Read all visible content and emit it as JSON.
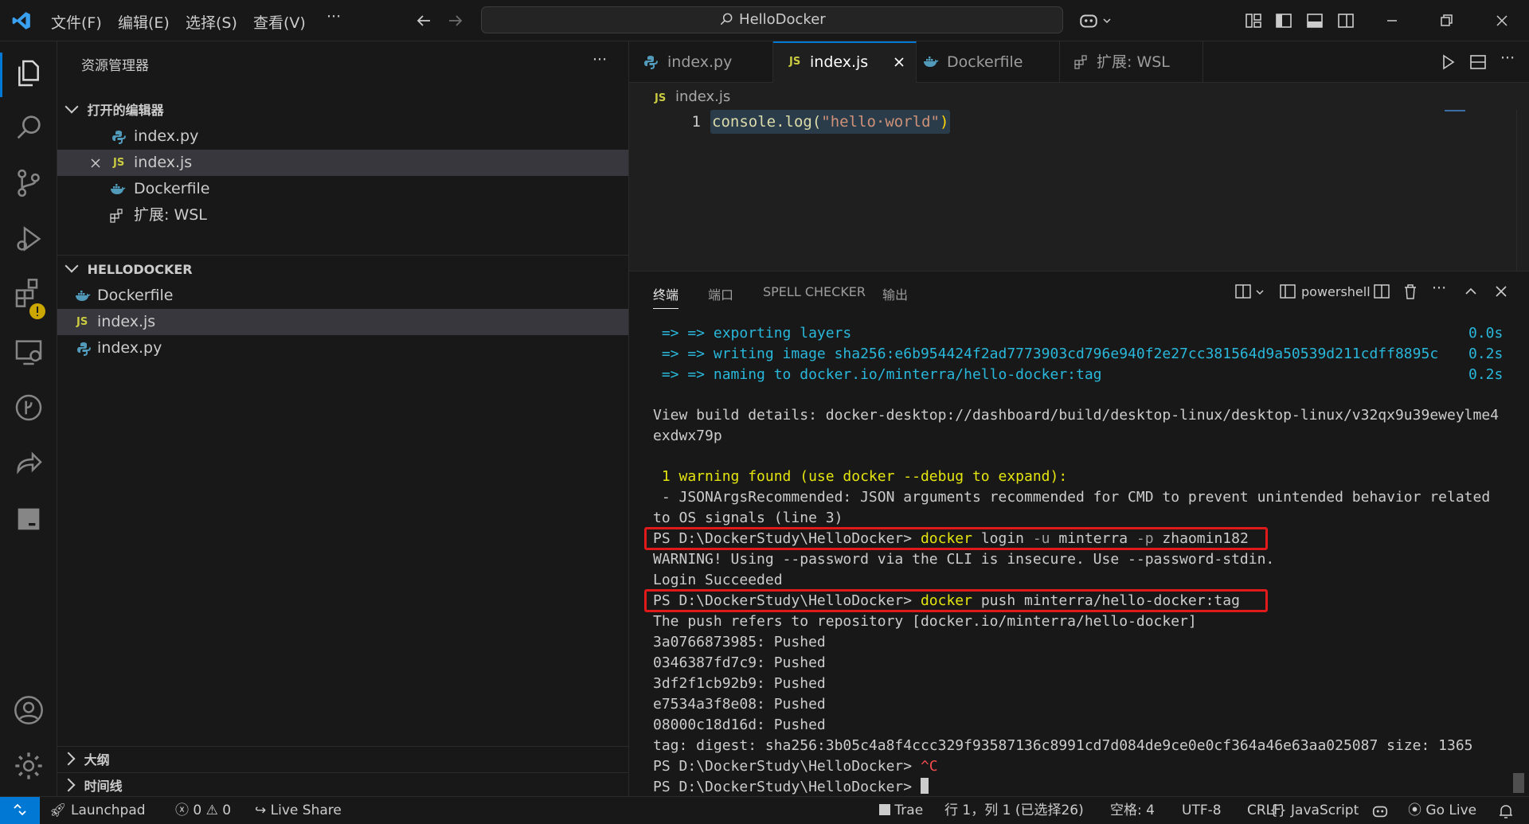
{
  "menu": {
    "file": "文件(F)",
    "edit": "编辑(E)",
    "select": "选择(S)",
    "view": "查看(V)",
    "more": "···"
  },
  "command_center": {
    "text": "HelloDocker"
  },
  "explorer": {
    "title": "资源管理器",
    "more": "···",
    "open_editors_label": "打开的编辑器",
    "open_editors": [
      {
        "name": "index.py",
        "icon": "python-icon"
      },
      {
        "name": "index.js",
        "icon": "js-icon",
        "badge": "JS"
      },
      {
        "name": "Dockerfile",
        "icon": "docker-icon"
      },
      {
        "name": "扩展: WSL",
        "icon": "extensions-icon"
      }
    ],
    "folder_label": "HELLODOCKER",
    "files": [
      {
        "name": "Dockerfile",
        "icon": "docker-icon"
      },
      {
        "name": "index.js",
        "icon": "js-icon",
        "badge": "JS"
      },
      {
        "name": "index.py",
        "icon": "python-icon"
      }
    ],
    "outline_label": "大纲",
    "timeline_label": "时间线"
  },
  "tabs": [
    {
      "label": "index.py",
      "icon": "python-icon"
    },
    {
      "label": "index.js",
      "badge": "JS",
      "active": true
    },
    {
      "label": "Dockerfile",
      "icon": "docker-icon"
    },
    {
      "label": "扩展: WSL",
      "icon": "extensions-icon"
    }
  ],
  "editor": {
    "breadcrumb_badge": "JS",
    "breadcrumb": "index.js",
    "line_number": "1",
    "code_fn": "console.log(",
    "code_str": "\"hello·world\"",
    "code_close": ")"
  },
  "panel": {
    "tabs": [
      "终端",
      "端口",
      "SPELL CHECKER",
      "输出"
    ],
    "shell": "powershell",
    "lines": [
      {
        "text": " => => exporting layers",
        "time": "0.0s",
        "color": "cyan"
      },
      {
        "text": " => => writing image sha256:e6b954424f2ad7773903cd796e940f2e27cc381564d9a50539d211cdff8895c",
        "time": "0.2s",
        "color": "cyan"
      },
      {
        "text": " => => naming to docker.io/minterra/hello-docker:tag",
        "time": "0.2s",
        "color": "cyan"
      },
      {
        "text": "",
        "color": "normal"
      },
      {
        "text": "View build details: docker-desktop://dashboard/build/desktop-linux/desktop-linux/v32qx9u39eweylme4",
        "color": "normal"
      },
      {
        "text": "exdwx79p",
        "color": "normal"
      },
      {
        "text": "",
        "color": "normal"
      },
      {
        "text": " 1 warning found (use docker --debug to expand):",
        "color": "yellow"
      },
      {
        "text": " - JSONArgsRecommended: JSON arguments recommended for CMD to prevent unintended behavior related",
        "color": "normal"
      },
      {
        "text": "to OS signals (line 3)",
        "color": "normal"
      }
    ],
    "cmd1": {
      "prompt": "PS D:\\DockerStudy\\HelloDocker> ",
      "cmd": "docker",
      "rest_a": " login ",
      "flag1": "-u",
      "rest_b": " minterra ",
      "flag2": "-p",
      "rest_c": " zhaomin182"
    },
    "after1": [
      "WARNING! Using --password via the CLI is insecure. Use --password-stdin.",
      "Login Succeeded"
    ],
    "cmd2": {
      "prompt": "PS D:\\DockerStudy\\HelloDocker> ",
      "cmd": "docker",
      "rest": " push minterra/hello-docker:tag"
    },
    "after2": [
      "The push refers to repository [docker.io/minterra/hello-docker]",
      "3a0766873985: Pushed",
      "0346387fd7c9: Pushed",
      "3df2f1cb92b9: Pushed",
      "e7534a3f8e08: Pushed",
      "08000c18d16d: Pushed",
      "tag: digest: sha256:3b05c4a8f4ccc329f93587136c8991cd7d084de9ce0e0cf364a46e63aa025087 size: 1365"
    ],
    "cmd3": {
      "prompt": "PS D:\\DockerStudy\\HelloDocker> ",
      "ctrl": "^C"
    },
    "cmd4": {
      "prompt": "PS D:\\DockerStudy\\HelloDocker> "
    }
  },
  "statusbar": {
    "launchpad": "Launchpad",
    "errors": "0",
    "warnings": "0",
    "liveshare": "Live Share",
    "trae": "Trae",
    "position": "行 1，列 1 (已选择26)",
    "spaces": "空格: 4",
    "encoding": "UTF-8",
    "eol": "CRLF",
    "language": "JavaScript",
    "golive": "Go Live"
  },
  "colors": {
    "accent": "#0078d4",
    "remote": "#0078d4",
    "highlight": "#e01a1a"
  }
}
